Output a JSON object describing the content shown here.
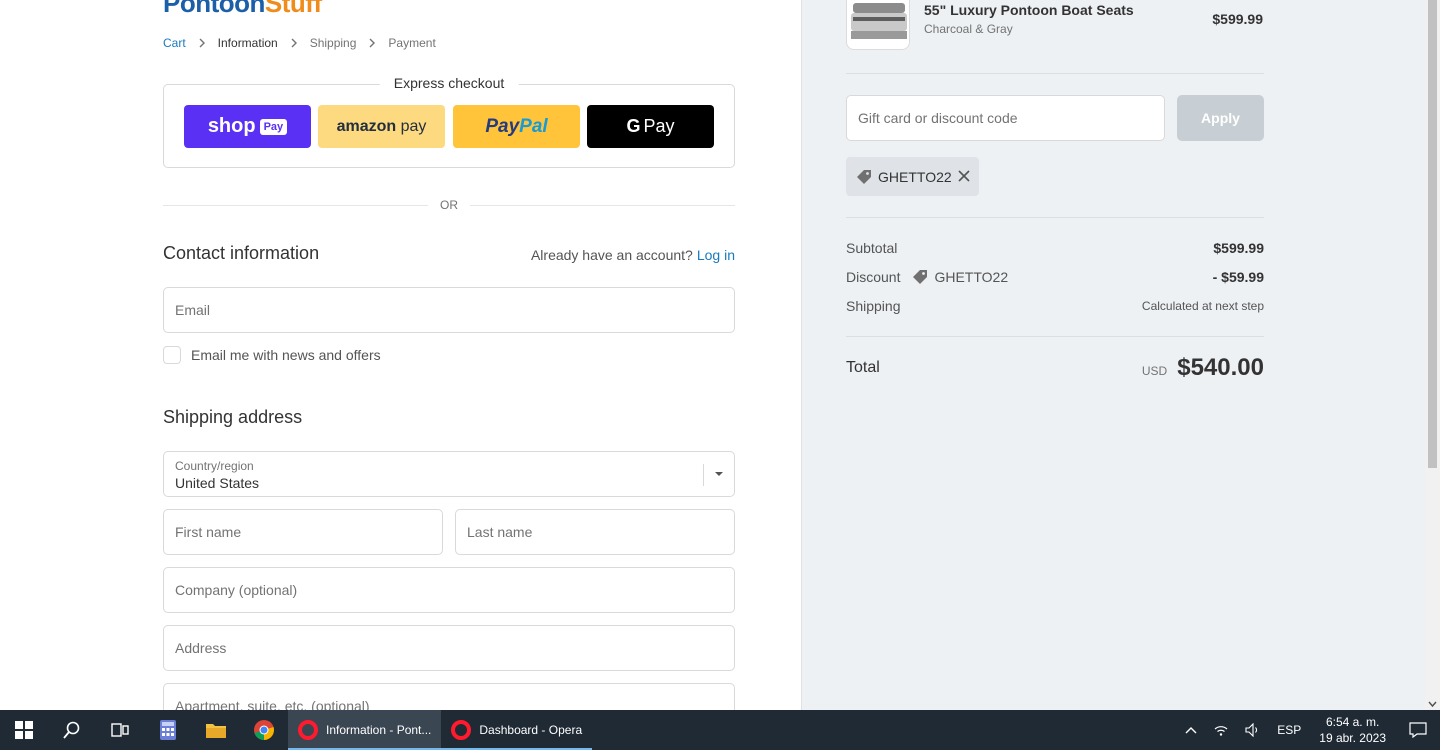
{
  "brand": {
    "part1": "Pontoon",
    "part2": "Stuff"
  },
  "breadcrumb": {
    "cart": "Cart",
    "information": "Information",
    "shipping": "Shipping",
    "payment": "Payment"
  },
  "express": {
    "title": "Express checkout",
    "shoppay": {
      "text": "shop",
      "box": "Pay"
    },
    "amazon": {
      "bold": "amazon",
      "rest": " pay"
    },
    "paypal": {
      "pay": "Pay",
      "pal": "Pal"
    },
    "gpay": {
      "g": "G",
      "rest": "Pay"
    }
  },
  "or_text": "OR",
  "contact": {
    "title": "Contact information",
    "account_prompt": "Already have an account?",
    "login": "Log in",
    "email_placeholder": "Email",
    "newsletter": "Email me with news and offers"
  },
  "shipping": {
    "title": "Shipping address",
    "country_label": "Country/region",
    "country_value": "United States",
    "first_name": "First name",
    "last_name": "Last name",
    "company": "Company (optional)",
    "address": "Address",
    "apartment": "Apartment, suite, etc. (optional)"
  },
  "summary": {
    "product": {
      "name": "55\" Luxury Pontoon Boat Seats",
      "variant": "Charcoal & Gray",
      "price": "$599.99"
    },
    "discount_placeholder": "Gift card or discount code",
    "apply": "Apply",
    "applied_code": "GHETTO22",
    "subtotal_label": "Subtotal",
    "subtotal_value": "$599.99",
    "discount_label": "Discount",
    "discount_code": "GHETTO22",
    "discount_value": "- $59.99",
    "shipping_label": "Shipping",
    "shipping_value": "Calculated at next step",
    "total_label": "Total",
    "currency": "USD",
    "total_value": "$540.00"
  },
  "taskbar": {
    "apps": [
      {
        "label": "Information - Pont...",
        "active": true
      },
      {
        "label": "Dashboard - Opera",
        "active": false
      }
    ],
    "language": "ESP",
    "time": "6:54 a. m.",
    "date": "19 abr. 2023"
  }
}
